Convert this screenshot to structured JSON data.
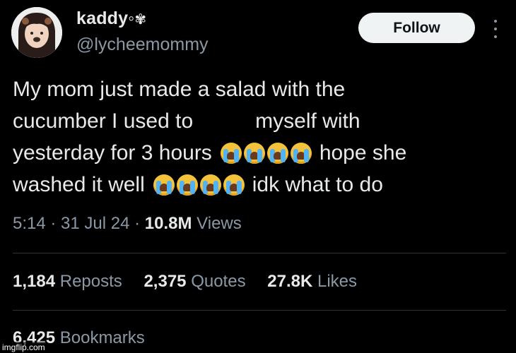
{
  "author": {
    "name": "kaddy◦",
    "name_glyph": "✾",
    "handle": "@lycheemommy"
  },
  "actions": {
    "follow_label": "Follow",
    "more_icon": "more-vertical-icon"
  },
  "tweet": {
    "line1": "My mom just made a salad with the",
    "line2a": "cucumber I used to",
    "line2b": "myself with",
    "line3a": "yesterday for 3 hours",
    "line3b": "hope she",
    "line4a": "washed it well",
    "line4b": "idk what to do",
    "emoji": "loudly-crying-face"
  },
  "meta": {
    "time": "5:14",
    "sep1": " · ",
    "date": "31 Jul 24",
    "sep2": " · ",
    "views_count": "10.8M",
    "views_label": "Views"
  },
  "stats": {
    "reposts_count": "1,184",
    "reposts_label": "Reposts",
    "quotes_count": "2,375",
    "quotes_label": "Quotes",
    "likes_count": "27.8K",
    "likes_label": "Likes",
    "bookmarks_count": "6,425",
    "bookmarks_label": "Bookmarks"
  },
  "watermark": "imgflip.com"
}
